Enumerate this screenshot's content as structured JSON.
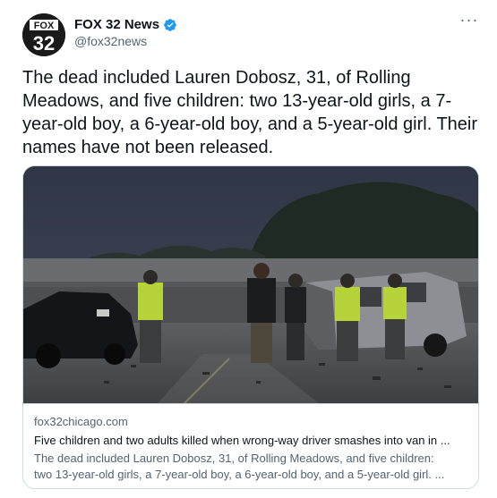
{
  "tweet": {
    "author": {
      "display_name": "FOX 32 News",
      "handle": "@fox32news",
      "verified": true,
      "avatar_icon": "fox32-logo-icon",
      "avatar_text_top": "FOX",
      "avatar_text_bottom": "32"
    },
    "more_icon": "more-options-icon",
    "text": "The dead included Lauren Dobosz, 31, of Rolling Meadows, and five children: two 13-year-old girls, a 7-year-old boy, a 6-year-old boy, and a 5-year-old girl. Their names have not been released.",
    "link_card": {
      "image_icon": "crash-scene-photo",
      "domain": "fox32chicago.com",
      "title": "Five children and two adults killed when wrong-way driver smashes into van in ...",
      "description_line1": "The dead included Lauren Dobosz, 31, of Rolling Meadows, and five children:",
      "description_line2": "two 13-year-old girls, a 7-year-old boy, a 6-year-old boy, and a 5-year-old girl. ..."
    }
  },
  "colors": {
    "text_primary": "#0f1419",
    "text_secondary": "#536471",
    "verified_blue": "#1d9bf0",
    "border": "#cfd9de"
  }
}
